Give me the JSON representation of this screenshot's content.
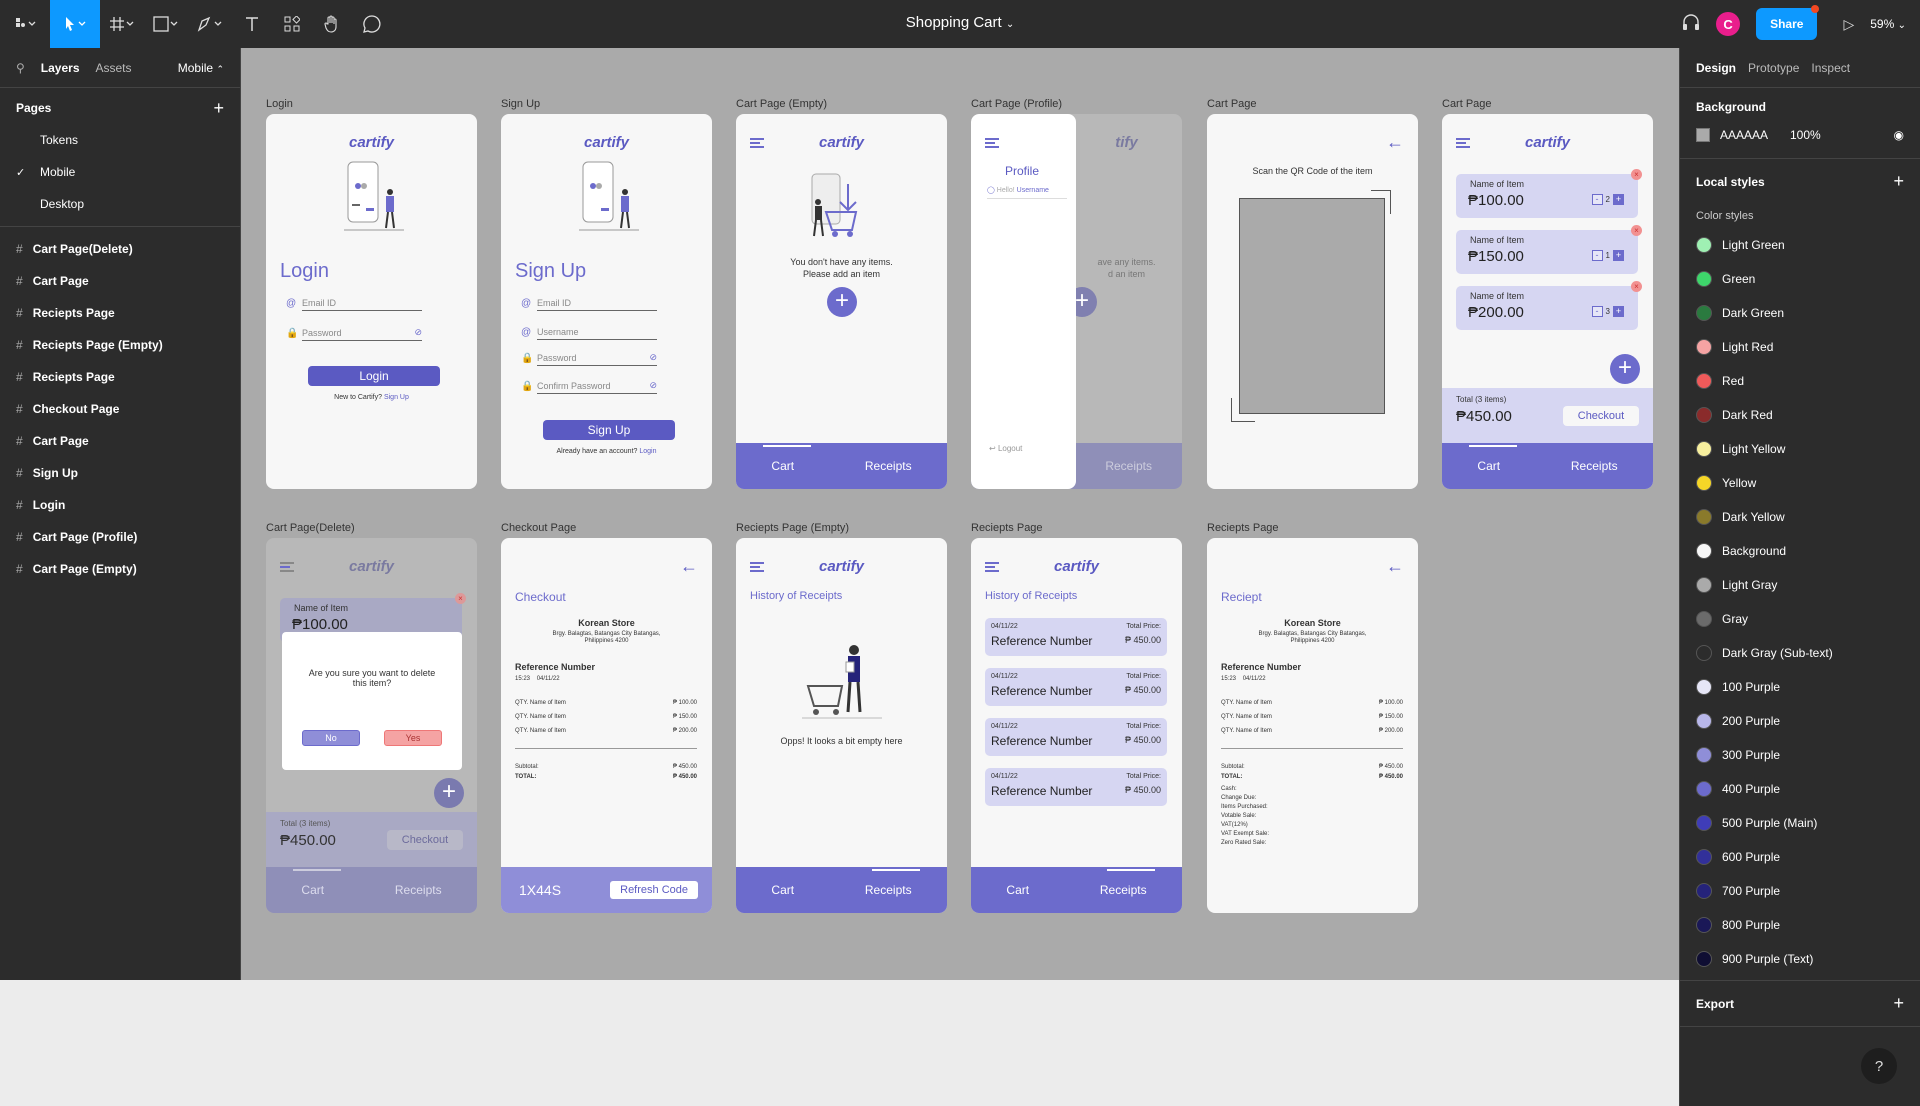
{
  "toolbar": {
    "title": "Shopping Cart",
    "share": "Share",
    "avatar": "C",
    "zoom": "59%"
  },
  "left": {
    "tab_layers": "Layers",
    "tab_assets": "Assets",
    "page_select": "Mobile",
    "pages_header": "Pages",
    "pages": [
      "Tokens",
      "Mobile",
      "Desktop"
    ],
    "layers": [
      "Cart Page(Delete)",
      "Cart Page",
      "Reciepts Page",
      "Reciepts Page (Empty)",
      "Reciepts Page",
      "Checkout Page",
      "Cart Page",
      "Sign Up",
      "Login",
      "Cart Page (Profile)",
      "Cart Page (Empty)"
    ]
  },
  "right": {
    "tabs": [
      "Design",
      "Prototype",
      "Inspect"
    ],
    "bg_header": "Background",
    "bg_hex": "AAAAAA",
    "bg_opacity": "100%",
    "local_styles": "Local styles",
    "color_styles": "Color styles",
    "export": "Export",
    "help": "?",
    "styles": [
      {
        "name": "Light Green",
        "color": "#9ff0b3"
      },
      {
        "name": "Green",
        "color": "#3ed56b"
      },
      {
        "name": "Dark Green",
        "color": "#2a7a3f"
      },
      {
        "name": "Light Red",
        "color": "#f5a3a3"
      },
      {
        "name": "Red",
        "color": "#ef5a5a"
      },
      {
        "name": "Dark Red",
        "color": "#8a2b2b"
      },
      {
        "name": "Light Yellow",
        "color": "#f7ef9e"
      },
      {
        "name": "Yellow",
        "color": "#f5d627"
      },
      {
        "name": "Dark Yellow",
        "color": "#8a7a2b"
      },
      {
        "name": "Background",
        "color": "#f7f7f7"
      },
      {
        "name": "Light Gray",
        "color": "#aaaaaa"
      },
      {
        "name": "Gray",
        "color": "#6b6b6b"
      },
      {
        "name": "Dark Gray (Sub-text)",
        "color": "#2c2c2c"
      },
      {
        "name": "100 Purple",
        "color": "#e6e6f7"
      },
      {
        "name": "200 Purple",
        "color": "#b8b7ea"
      },
      {
        "name": "300 Purple",
        "color": "#8f8ed8"
      },
      {
        "name": "400 Purple",
        "color": "#6c6bcc"
      },
      {
        "name": "500 Purple (Main)",
        "color": "#3f3db8"
      },
      {
        "name": "600 Purple",
        "color": "#32309a"
      },
      {
        "name": "700 Purple",
        "color": "#25237a"
      },
      {
        "name": "800 Purple",
        "color": "#1a1857"
      },
      {
        "name": "900 Purple (Text)",
        "color": "#0f0e33"
      }
    ]
  },
  "frames": {
    "login": {
      "label": "Login",
      "logo": "cartify",
      "title": "Login",
      "email": "Email ID",
      "password": "Password",
      "btn": "Login",
      "foot": "New to Cartify?",
      "foot_link": "Sign Up"
    },
    "signup": {
      "label": "Sign Up",
      "logo": "cartify",
      "title": "Sign Up",
      "email": "Email ID",
      "username": "Username",
      "password": "Password",
      "confirm": "Confirm Password",
      "btn": "Sign Up",
      "foot": "Already have an account?",
      "foot_link": "Login"
    },
    "empty": {
      "label": "Cart Page (Empty)",
      "logo": "cartify",
      "msg1": "You don't have any items.",
      "msg2": "Please add an item",
      "cart": "Cart",
      "receipts": "Receipts"
    },
    "profile": {
      "label": "Cart Page (Profile)",
      "profile": "Profile",
      "hello": "Hello!",
      "username": "Username",
      "logout": "Logout",
      "receipts": "Receipts",
      "msg1": "ave any items.",
      "msg2": "d an item",
      "logo_part": "tify"
    },
    "scan": {
      "label": "Cart Page",
      "msg": "Scan the QR Code of the item"
    },
    "cart": {
      "label": "Cart Page",
      "logo": "cartify",
      "items": [
        {
          "name": "Name of Item",
          "price": "₱100.00",
          "qty": "2"
        },
        {
          "name": "Name of Item",
          "price": "₱150.00",
          "qty": "1"
        },
        {
          "name": "Name of Item",
          "price": "₱200.00",
          "qty": "3"
        }
      ],
      "total_label": "Total (3 items)",
      "total": "₱450.00",
      "checkout": "Checkout",
      "cart": "Cart",
      "receipts": "Receipts"
    },
    "delete": {
      "label": "Cart Page(Delete)",
      "logo": "cartify",
      "item_name": "Name of Item",
      "item_price": "₱100.00",
      "question": "Are you sure you want to delete this item?",
      "no": "No",
      "yes": "Yes",
      "total_label": "Total (3 items)",
      "total": "₱450.00",
      "checkout": "Checkout",
      "cart": "Cart",
      "receipts": "Receipts"
    },
    "checkout": {
      "label": "Checkout Page",
      "title": "Checkout",
      "store": "Korean Store",
      "addr1": "Brgy. Balagtas, Batangas City Batangas,",
      "addr2": "Philippines 4200",
      "ref": "Reference Number",
      "time": "15:23",
      "date": "04/11/22",
      "lines": [
        [
          "QTY. Name of Item",
          "₱ 100.00"
        ],
        [
          "QTY. Name of Item",
          "₱ 150.00"
        ],
        [
          "QTY. Name of Item",
          "₱ 200.00"
        ]
      ],
      "subtotal": "Subtotal:",
      "subtotal_v": "₱ 450.00",
      "total": "TOTAL:",
      "total_v": "₱ 450.00",
      "code": "1X44S",
      "refresh": "Refresh Code"
    },
    "rec_empty": {
      "label": "Reciepts Page (Empty)",
      "logo": "cartify",
      "title": "History of Receipts",
      "msg": "Opps! It looks a bit empty here",
      "cart": "Cart",
      "receipts": "Receipts"
    },
    "rec": {
      "label": "Reciepts Page",
      "logo": "cartify",
      "title": "History of Receipts",
      "rows": [
        {
          "date": "04/11/22",
          "ref": "Reference Number",
          "tl": "Total Price:",
          "tv": "₱ 450.00"
        },
        {
          "date": "04/11/22",
          "ref": "Reference Number",
          "tl": "Total Price:",
          "tv": "₱ 450.00"
        },
        {
          "date": "04/11/22",
          "ref": "Reference Number",
          "tl": "Total Price:",
          "tv": "₱ 450.00"
        },
        {
          "date": "04/11/22",
          "ref": "Reference Number",
          "tl": "Total Price:",
          "tv": "₱ 450.00"
        }
      ],
      "cart": "Cart",
      "receipts": "Receipts"
    },
    "receipt": {
      "label": "Reciepts Page",
      "title": "Reciept",
      "store": "Korean Store",
      "addr1": "Brgy. Balagtas, Batangas City Batangas,",
      "addr2": "Philippines 4200",
      "ref": "Reference Number",
      "time": "15:23",
      "date": "04/11/22",
      "lines": [
        [
          "QTY. Name of Item",
          "₱ 100.00"
        ],
        [
          "QTY. Name of Item",
          "₱ 150.00"
        ],
        [
          "QTY. Name of Item",
          "₱ 200.00"
        ]
      ],
      "subtotal": "Subtotal:",
      "subtotal_v": "₱ 450.00",
      "total": "TOTAL:",
      "total_v": "₱ 450.00",
      "extras": [
        "Cash:",
        "Change Due:",
        "Items Purchased:",
        "Votable Sale:",
        "VAT(12%)",
        "VAT Exempt Sale:",
        "Zero Rated Sale:"
      ]
    }
  }
}
